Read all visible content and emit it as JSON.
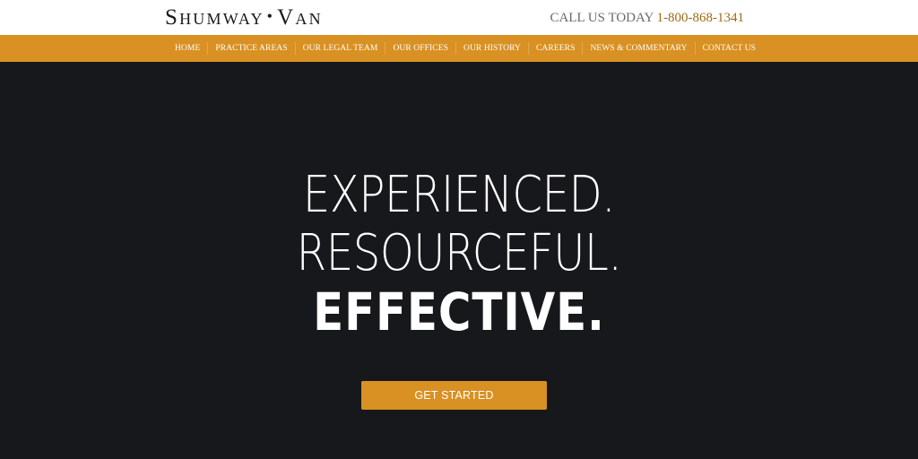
{
  "header": {
    "logo_left": "Shumway",
    "logo_dot": "•",
    "logo_right": "Van",
    "phone_label": "CALL US TODAY",
    "phone_number": "1-800-868-1341"
  },
  "nav": {
    "items": [
      {
        "label": "HOME"
      },
      {
        "label": "PRACTICE AREAS"
      },
      {
        "label": "OUR LEGAL TEAM"
      },
      {
        "label": "OUR OFFICES"
      },
      {
        "label": "OUR HISTORY"
      },
      {
        "label": "CAREERS"
      },
      {
        "label": "NEWS & COMMENTARY"
      },
      {
        "label": "CONTACT US"
      }
    ]
  },
  "hero": {
    "line1": "EXPERIENCED.",
    "line2": "RESOURCEFUL.",
    "line3": "EFFECTIVE.",
    "cta_label": "GET STARTED"
  },
  "colors": {
    "accent": "#d99123",
    "hero_background": "#17181c",
    "phone_number": "#9a6a18"
  }
}
